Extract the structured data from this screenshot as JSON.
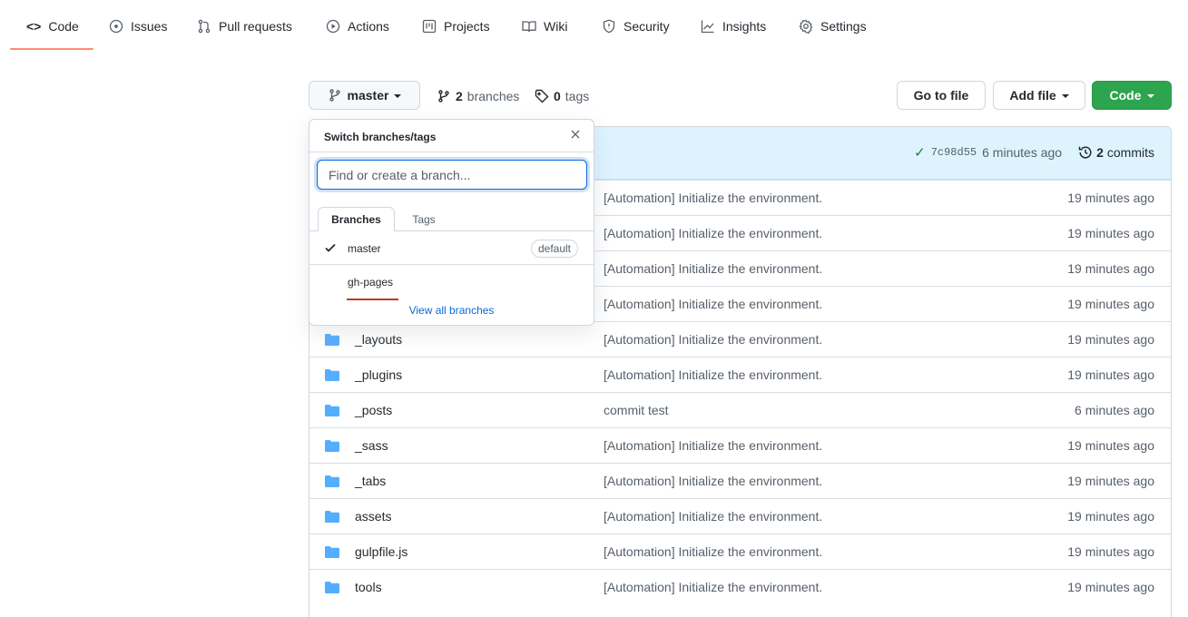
{
  "nav": {
    "items": [
      {
        "label": "Code",
        "icon": "code-icon"
      },
      {
        "label": "Issues",
        "icon": "issue-circle-icon"
      },
      {
        "label": "Pull requests",
        "icon": "pull-request-icon"
      },
      {
        "label": "Actions",
        "icon": "play-icon"
      },
      {
        "label": "Projects",
        "icon": "project-board-icon"
      },
      {
        "label": "Wiki",
        "icon": "book-icon"
      },
      {
        "label": "Security",
        "icon": "shield-icon"
      },
      {
        "label": "Insights",
        "icon": "graph-icon"
      },
      {
        "label": "Settings",
        "icon": "gear-icon"
      }
    ],
    "selected": "Code"
  },
  "toolbar": {
    "branch_label": "master",
    "branches_count": "2",
    "branches_word": "branches",
    "tags_count": "0",
    "tags_word": "tags",
    "go_to_file": "Go to file",
    "add_file": "Add file",
    "code": "Code"
  },
  "commit": {
    "check": "✓",
    "sha": "7c98d55",
    "time": "6 minutes ago",
    "commits_count": "2",
    "commits_word": "commits"
  },
  "files": [
    {
      "name": "",
      "message": "[Automation] Initialize the environment.",
      "age": "19 minutes ago"
    },
    {
      "name": "",
      "message": "[Automation] Initialize the environment.",
      "age": "19 minutes ago"
    },
    {
      "name": "",
      "message": "[Automation] Initialize the environment.",
      "age": "19 minutes ago"
    },
    {
      "name": "",
      "message": "[Automation] Initialize the environment.",
      "age": "19 minutes ago"
    },
    {
      "name": "_layouts",
      "message": "[Automation] Initialize the environment.",
      "age": "19 minutes ago"
    },
    {
      "name": "_plugins",
      "message": "[Automation] Initialize the environment.",
      "age": "19 minutes ago"
    },
    {
      "name": "_posts",
      "message": "commit test",
      "age": "6 minutes ago"
    },
    {
      "name": "_sass",
      "message": "[Automation] Initialize the environment.",
      "age": "19 minutes ago"
    },
    {
      "name": "_tabs",
      "message": "[Automation] Initialize the environment.",
      "age": "19 minutes ago"
    },
    {
      "name": "assets",
      "message": "[Automation] Initialize the environment.",
      "age": "19 minutes ago"
    },
    {
      "name": "gulpfile.js",
      "message": "[Automation] Initialize the environment.",
      "age": "19 minutes ago"
    },
    {
      "name": "tools",
      "message": "[Automation] Initialize the environment.",
      "age": "19 minutes ago"
    }
  ],
  "dropdown": {
    "title": "Switch branches/tags",
    "filter_placeholder": "Find or create a branch...",
    "tabs": {
      "branches": "Branches",
      "tags": "Tags"
    },
    "branches": [
      {
        "name": "master",
        "checked": true,
        "badge": "default"
      },
      {
        "name": "gh-pages",
        "checked": false,
        "badge": ""
      }
    ],
    "view_all": "View all branches"
  },
  "colors": {
    "accent_blue": "#0969da",
    "green_button": "#2da44e",
    "nav_underline": "#fd8c73",
    "folder_blue": "#54aeff",
    "commit_bar": "#ddf4ff"
  }
}
